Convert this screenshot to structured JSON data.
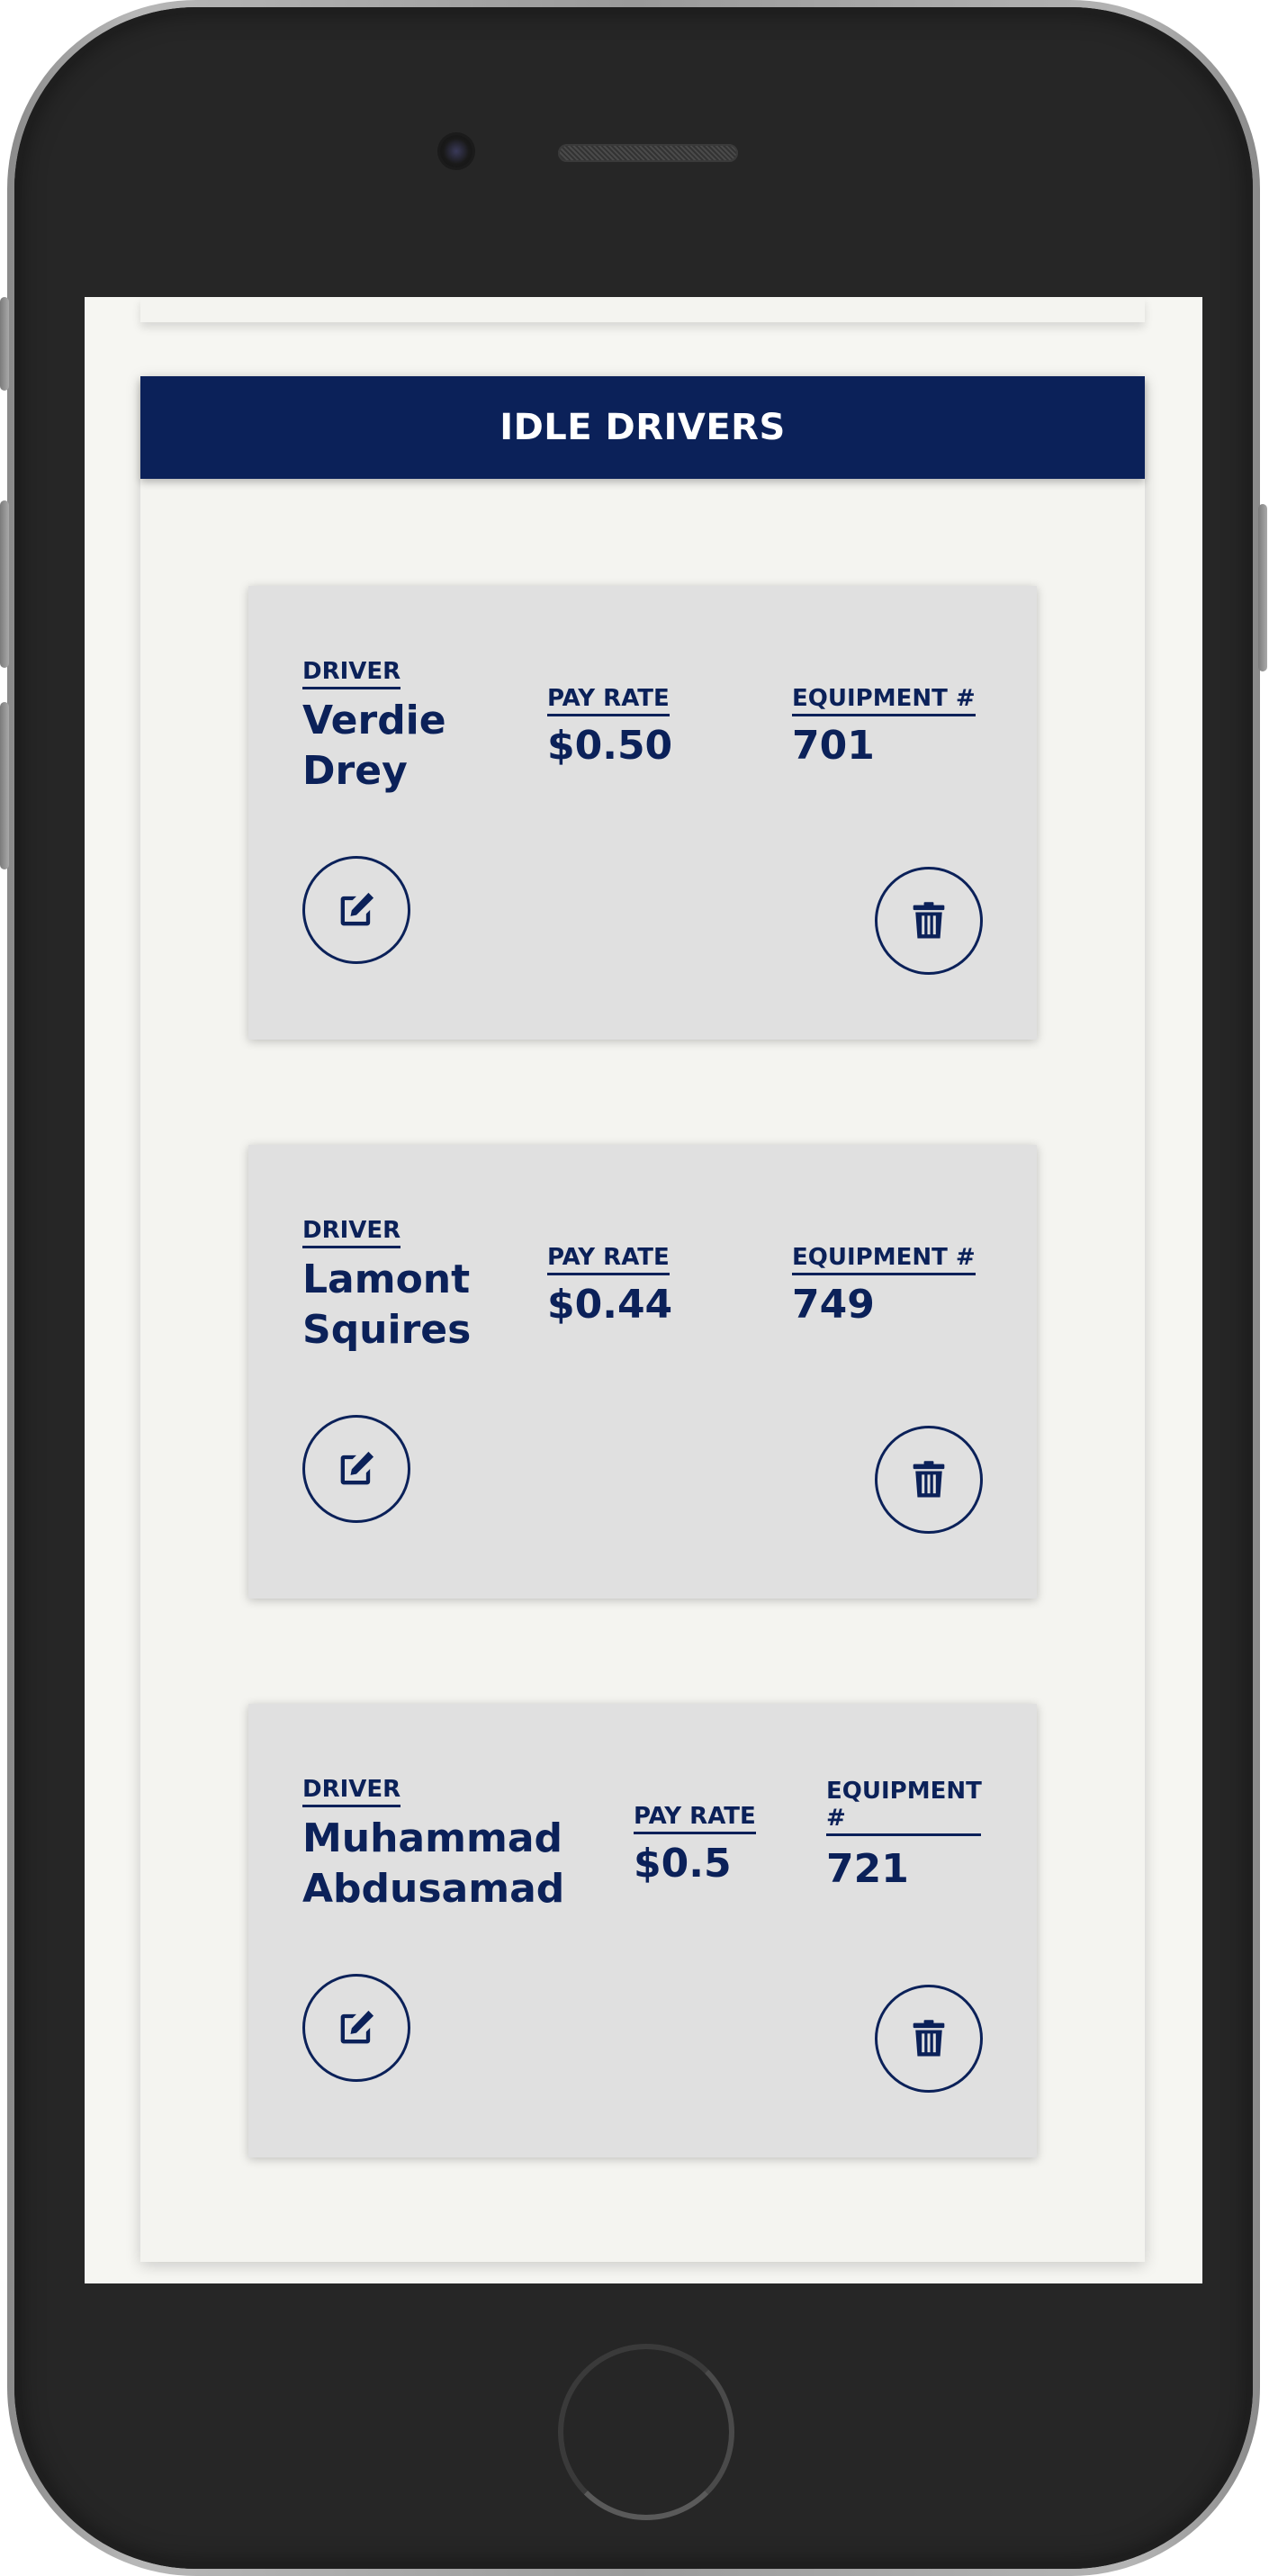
{
  "section": {
    "title": "IDLE DRIVERS"
  },
  "labels": {
    "driver": "DRIVER",
    "pay_rate": "PAY RATE",
    "equipment": "EQUIPMENT #"
  },
  "drivers": [
    {
      "first": "Verdie",
      "last": "Drey",
      "pay_rate": "$0.50",
      "equipment": "701"
    },
    {
      "first": "Lamont",
      "last": "Squires",
      "pay_rate": "$0.44",
      "equipment": "749"
    },
    {
      "first": "Muhammad",
      "last": "Abdusamad",
      "pay_rate": "$0.5",
      "equipment": "721"
    }
  ],
  "icons": {
    "edit": "edit-icon",
    "delete": "trash-icon"
  },
  "colors": {
    "brand": "#0b2159",
    "card": "#e0e0e0",
    "screen": "#f6f6f2"
  }
}
